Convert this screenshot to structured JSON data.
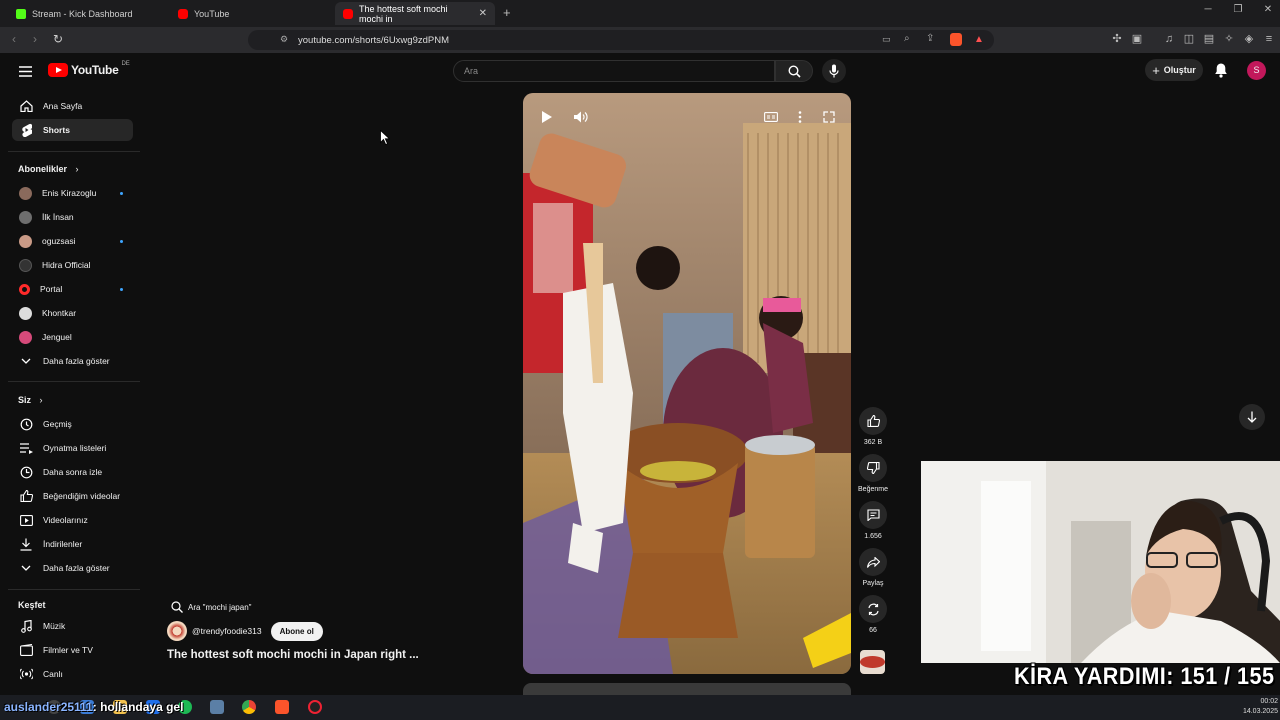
{
  "browser": {
    "tabs": [
      {
        "label": "Stream - Kick Dashboard",
        "color": "#53fc18"
      },
      {
        "label": "YouTube",
        "color": "#ff0000"
      },
      {
        "label": "The hottest soft mochi mochi in",
        "color": "#ff0000"
      }
    ],
    "url": "youtube.com/shorts/6Uxwg9zdPNM"
  },
  "header": {
    "logo_word": "YouTube",
    "country": "DE",
    "search_placeholder": "Ara",
    "create_label": "Oluştur",
    "avatar_letter": "S"
  },
  "sidebar": {
    "main": [
      {
        "label": "Ana Sayfa",
        "icon": "home-icon"
      },
      {
        "label": "Shorts",
        "icon": "shorts-icon",
        "active": true
      }
    ],
    "subscriptions_title": "Abonelikler",
    "subscriptions": [
      {
        "label": "Enis Kirazoglu",
        "color": "#8a6a5c",
        "live": true
      },
      {
        "label": "İlk İnsan",
        "color": "#6e6e6e",
        "live": false
      },
      {
        "label": "oguzsasi",
        "color": "#c99a86",
        "live": true
      },
      {
        "label": "Hidra Official",
        "color": "#333333",
        "live": false
      },
      {
        "label": "Portal",
        "color": "#ff2a2a",
        "live": true
      },
      {
        "label": "Khontkar",
        "color": "#dddddd",
        "live": false
      },
      {
        "label": "Jenguel",
        "color": "#d64a7a",
        "live": false
      }
    ],
    "show_more_1": "Daha fazla göster",
    "you_title": "Siz",
    "you": [
      {
        "label": "Geçmiş",
        "icon": "history-icon"
      },
      {
        "label": "Oynatma listeleri",
        "icon": "playlist-icon"
      },
      {
        "label": "Daha sonra izle",
        "icon": "clock-icon"
      },
      {
        "label": "Beğendiğim videolar",
        "icon": "like-icon"
      },
      {
        "label": "Videolarınız",
        "icon": "video-icon"
      },
      {
        "label": "İndirilenler",
        "icon": "download-icon"
      }
    ],
    "show_more_2": "Daha fazla göster",
    "explore_title": "Keşfet",
    "explore": [
      {
        "label": "Müzik",
        "icon": "music-icon"
      },
      {
        "label": "Filmler ve TV",
        "icon": "film-icon"
      },
      {
        "label": "Canlı",
        "icon": "live-icon"
      }
    ]
  },
  "short": {
    "suggest": "Ara \"mochi japan\"",
    "channel": "@trendyfoodie313",
    "subscribe_label": "Abone ol",
    "title": "The hottest soft mochi mochi in Japan right ...",
    "actions": {
      "likes": "362 B",
      "dislike": "Beğenme",
      "comments": "1.656",
      "share": "Paylaş",
      "remix": "66"
    }
  },
  "stream_overlay": {
    "rent_text": "KİRA YARDIMI:  151 / 155",
    "chat_user": "auslander25111",
    "chat_message": ": hollandaya gel"
  },
  "taskbar": {
    "time": "00:02",
    "date": "14.03.2025"
  }
}
